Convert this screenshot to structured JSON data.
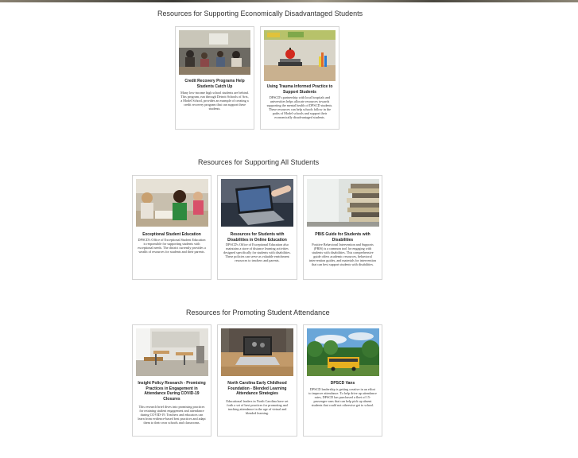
{
  "sections": [
    {
      "title": "Resources for Supporting Economically Disadvantaged Students",
      "cards": [
        {
          "title": "Credit Recovery Programs Help Students Catch Up",
          "body": "Many low-income high school students are behind. This program, run through Detroit Schools of Arts, a Model School, provides an example of creating a credit recovery program that can support these students.",
          "image_icon": "classroom-photo"
        },
        {
          "title": "Using Trauma Informed Practice to Support Students",
          "body": "DPSCD's partnership with local hospitals and universities helps allocate resources towards supporting the mental health of DPSCD students. These resources can help schools follow in the paths of Model schools and support their economically disadvantaged students.",
          "image_icon": "apple-books-photo"
        }
      ]
    },
    {
      "title": "Resources for Supporting All Students",
      "cards": [
        {
          "title": "Exceptional Student Education",
          "body": "DPSCD's Office of Exceptional Student Education is responsible for supporting students with exceptional needs. The district currently provides a wealth of resources for students and their parents.",
          "image_icon": "children-reading-photo"
        },
        {
          "title": "Resources for Students with Disabilities in Online Education",
          "body": "DPSCD's Office of Exceptional Education also maintains a store of distance learning activities designed specifically for students with disabilities. These policies can serve as valuable enrichment resources to teachers and parents.",
          "image_icon": "laptop-hand-photo"
        },
        {
          "title": "PBIS Guide for Students with Disabilities",
          "body": "Positive Behavioral Intervention and Supports (PBIS) is a common tool for engaging with students with disabilities. This comprehensive guide offers academic resources, behavioral intervention guides, and materials for intervention that can best support students with disabilities.",
          "image_icon": "book-stack-photo"
        }
      ]
    },
    {
      "title": "Resources for Promoting Student Attendance",
      "cards": [
        {
          "title": "Insight Policy Research - Promising Practices in Engagement in Attendance During COVID-19 Closures",
          "body": "This research brief dives into promising practices for retaining student engagement and attendance during COVID-19. Teachers and educators can learn from evidence-based best practices and adapt them to their own schools and classrooms.",
          "image_icon": "empty-classroom-photo"
        },
        {
          "title": "North Carolina Early Childhood Foundation - Blended Learning Attendance Strategies",
          "body": "Educational leaders in North Carolina have set forth a set of best practices for promoting and tracking attendance in the age of virtual and blended learning.",
          "image_icon": "laptop-desk-photo"
        },
        {
          "title": "DPSCD Vans",
          "body": "DPSCD leadership is getting creative in an effort to improve attendance. To help drive up attendance rates, DPSCD has purchased a fleet of 15-passenger vans that can help pick up absent students that could not otherwise get to school.",
          "image_icon": "school-bus-photo"
        }
      ]
    }
  ]
}
